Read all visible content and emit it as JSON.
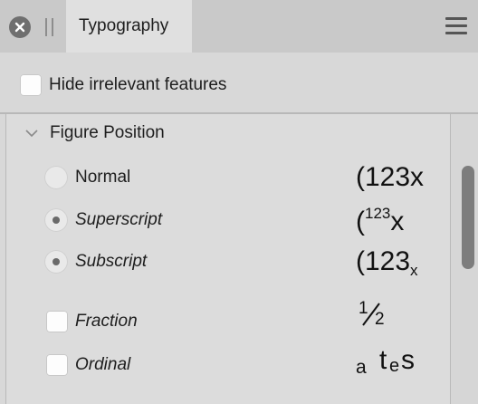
{
  "tab": {
    "label": "Typography"
  },
  "panel": {
    "hide_irrelevant": {
      "label": "Hide irrelevant features",
      "checked": false
    }
  },
  "section": {
    "title": "Figure Position",
    "expanded": true
  },
  "options": [
    {
      "label": "Normal",
      "type": "radio",
      "selected": false,
      "preview": {
        "base": "(123x"
      }
    },
    {
      "label": "Superscript",
      "type": "radio",
      "selected": true,
      "preview": {
        "base": "(",
        "raised": "123",
        "tail": "x"
      }
    },
    {
      "label": "Subscript",
      "type": "radio",
      "selected": true,
      "preview": {
        "base": "(123",
        "lowered": "x"
      }
    },
    {
      "label": "Fraction",
      "type": "checkbox",
      "checked": false,
      "preview": {
        "numerator": "1",
        "denominator": "2"
      }
    },
    {
      "label": "Ordinal",
      "type": "checkbox",
      "checked": false,
      "preview": {
        "a": "a",
        "t": "t",
        "e": "e",
        "s": "s"
      }
    }
  ],
  "icons": {
    "close": "close-icon",
    "grip": "grip-icon",
    "menu": "hamburger-menu-icon",
    "chevron": "chevron-down-icon"
  },
  "colors": {
    "panel_bg": "#d8d8d8",
    "titlebar_bg": "#c9c9c9",
    "tab_bg": "#e0e0e0",
    "scroll_thumb": "#7d7d7d"
  }
}
